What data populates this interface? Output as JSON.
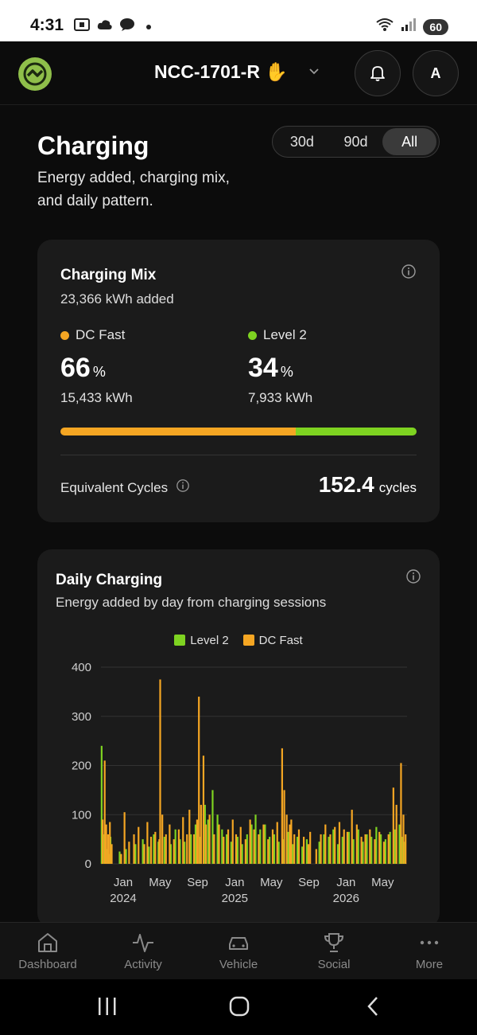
{
  "status_bar": {
    "time": "4:31",
    "battery": "60"
  },
  "header": {
    "vehicle_name": "NCC-1701-R ✋",
    "avatar_initial": "A"
  },
  "page": {
    "title": "Charging",
    "subtitle": "Energy added, charging mix, and daily pattern."
  },
  "range": {
    "options": [
      "30d",
      "90d",
      "All"
    ],
    "selected": "All"
  },
  "mix": {
    "title": "Charging Mix",
    "total": "23,366 kWh added",
    "dc": {
      "label": "DC Fast",
      "pct": "66",
      "unit": "%",
      "kwh": "15,433 kWh",
      "color": "#f5a623"
    },
    "l2": {
      "label": "Level 2",
      "pct": "34",
      "unit": "%",
      "kwh": "7,933 kWh",
      "color": "#7ed321"
    },
    "bar_fraction_dc": 0.66,
    "cycles_label": "Equivalent Cycles",
    "cycles_value": "152.4",
    "cycles_unit": "cycles"
  },
  "daily": {
    "title": "Daily Charging",
    "subtitle": "Energy added by day from charging sessions"
  },
  "chart_data": {
    "type": "bar",
    "stacked": true,
    "title": "Daily Charging",
    "legend": [
      {
        "name": "Level 2",
        "color": "#7ed321"
      },
      {
        "name": "DC Fast",
        "color": "#f5a623"
      }
    ],
    "legend_position": "top",
    "ylim": [
      0,
      400
    ],
    "yticks": [
      "400",
      "300",
      "200",
      "100",
      "0"
    ],
    "xticks": [
      {
        "label": "Jan",
        "year": "2024",
        "t": "2024-01-01"
      },
      {
        "label": "May",
        "year": "",
        "t": "2024-05-01"
      },
      {
        "label": "Sep",
        "year": "",
        "t": "2024-09-01"
      },
      {
        "label": "Jan",
        "year": "2025",
        "t": "2025-01-01"
      },
      {
        "label": "May",
        "year": "",
        "t": "2025-05-01"
      },
      {
        "label": "Sep",
        "year": "",
        "t": "2025-09-01"
      },
      {
        "label": "Jan",
        "year": "2026",
        "t": "2026-01-01"
      },
      {
        "label": "May",
        "year": "",
        "t": "2026-05-01"
      }
    ],
    "xlim": [
      "2023-10-20",
      "2026-07-20"
    ],
    "grid": true,
    "series": [
      {
        "name": "Level 2",
        "values": [
          [
            "2023-10-22",
            240
          ],
          [
            "2023-10-28",
            60
          ],
          [
            "2023-11-03",
            45
          ],
          [
            "2023-11-08",
            30
          ],
          [
            "2023-11-14",
            20
          ],
          [
            "2023-11-20",
            55
          ],
          [
            "2023-12-20",
            25
          ],
          [
            "2024-01-10",
            30
          ],
          [
            "2024-02-10",
            40
          ],
          [
            "2024-03-05",
            50
          ],
          [
            "2024-03-25",
            35
          ],
          [
            "2024-04-10",
            60
          ],
          [
            "2024-04-25",
            45
          ],
          [
            "2024-05-15",
            55
          ],
          [
            "2024-06-05",
            40
          ],
          [
            "2024-06-20",
            70
          ],
          [
            "2024-07-05",
            50
          ],
          [
            "2024-07-20",
            45
          ],
          [
            "2024-08-10",
            60
          ],
          [
            "2024-08-25",
            80
          ],
          [
            "2024-09-10",
            55
          ],
          [
            "2024-09-25",
            120
          ],
          [
            "2024-10-05",
            90
          ],
          [
            "2024-10-20",
            150
          ],
          [
            "2024-11-05",
            100
          ],
          [
            "2024-11-20",
            70
          ],
          [
            "2024-12-05",
            60
          ],
          [
            "2024-12-20",
            45
          ],
          [
            "2025-01-10",
            55
          ],
          [
            "2025-01-25",
            40
          ],
          [
            "2025-02-10",
            60
          ],
          [
            "2025-02-25",
            80
          ],
          [
            "2025-03-10",
            100
          ],
          [
            "2025-03-25",
            70
          ],
          [
            "2025-04-10",
            80
          ],
          [
            "2025-04-25",
            55
          ],
          [
            "2025-05-10",
            60
          ],
          [
            "2025-05-25",
            45
          ],
          [
            "2025-06-10",
            50
          ],
          [
            "2025-06-25",
            65
          ],
          [
            "2025-07-10",
            40
          ],
          [
            "2025-07-25",
            55
          ],
          [
            "2025-08-10",
            35
          ],
          [
            "2025-08-25",
            50
          ],
          [
            "2025-10-05",
            45
          ],
          [
            "2025-10-20",
            60
          ],
          [
            "2025-11-05",
            55
          ],
          [
            "2025-11-20",
            70
          ],
          [
            "2025-12-05",
            40
          ],
          [
            "2025-12-20",
            55
          ],
          [
            "2026-01-10",
            65
          ],
          [
            "2026-01-25",
            50
          ],
          [
            "2026-02-10",
            70
          ],
          [
            "2026-02-25",
            45
          ],
          [
            "2026-03-10",
            60
          ],
          [
            "2026-03-25",
            55
          ],
          [
            "2026-04-10",
            75
          ],
          [
            "2026-04-25",
            60
          ],
          [
            "2026-05-10",
            50
          ],
          [
            "2026-05-25",
            65
          ],
          [
            "2026-06-10",
            70
          ],
          [
            "2026-06-25",
            80
          ],
          [
            "2026-07-05",
            55
          ],
          [
            "2026-07-12",
            45
          ]
        ]
      },
      {
        "name": "DC Fast",
        "values": [
          [
            "2023-10-25",
            90
          ],
          [
            "2023-11-01",
            210
          ],
          [
            "2023-11-06",
            80
          ],
          [
            "2023-11-12",
            60
          ],
          [
            "2023-11-18",
            85
          ],
          [
            "2023-11-24",
            40
          ],
          [
            "2023-12-25",
            20
          ],
          [
            "2024-01-05",
            105
          ],
          [
            "2024-01-20",
            45
          ],
          [
            "2024-02-05",
            60
          ],
          [
            "2024-02-20",
            75
          ],
          [
            "2024-03-10",
            40
          ],
          [
            "2024-03-20",
            85
          ],
          [
            "2024-04-01",
            55
          ],
          [
            "2024-04-15",
            65
          ],
          [
            "2024-04-28",
            50
          ],
          [
            "2024-05-01",
            375
          ],
          [
            "2024-05-08",
            100
          ],
          [
            "2024-05-20",
            60
          ],
          [
            "2024-06-01",
            80
          ],
          [
            "2024-06-15",
            50
          ],
          [
            "2024-07-01",
            70
          ],
          [
            "2024-07-15",
            95
          ],
          [
            "2024-07-28",
            60
          ],
          [
            "2024-08-05",
            110
          ],
          [
            "2024-08-20",
            60
          ],
          [
            "2024-08-30",
            90
          ],
          [
            "2024-09-05",
            340
          ],
          [
            "2024-09-12",
            120
          ],
          [
            "2024-09-20",
            220
          ],
          [
            "2024-09-28",
            80
          ],
          [
            "2024-10-10",
            100
          ],
          [
            "2024-10-25",
            60
          ],
          [
            "2024-11-10",
            80
          ],
          [
            "2024-11-25",
            55
          ],
          [
            "2024-12-10",
            70
          ],
          [
            "2024-12-25",
            90
          ],
          [
            "2025-01-05",
            60
          ],
          [
            "2025-01-20",
            75
          ],
          [
            "2025-02-05",
            50
          ],
          [
            "2025-02-20",
            90
          ],
          [
            "2025-03-05",
            70
          ],
          [
            "2025-03-20",
            60
          ],
          [
            "2025-04-05",
            80
          ],
          [
            "2025-04-20",
            50
          ],
          [
            "2025-05-05",
            70
          ],
          [
            "2025-05-20",
            85
          ],
          [
            "2025-06-05",
            235
          ],
          [
            "2025-06-12",
            150
          ],
          [
            "2025-06-20",
            100
          ],
          [
            "2025-06-30",
            80
          ],
          [
            "2025-07-05",
            90
          ],
          [
            "2025-07-15",
            60
          ],
          [
            "2025-07-30",
            70
          ],
          [
            "2025-08-15",
            55
          ],
          [
            "2025-08-30",
            40
          ],
          [
            "2025-09-05",
            65
          ],
          [
            "2025-09-25",
            30
          ],
          [
            "2025-10-10",
            60
          ],
          [
            "2025-10-25",
            80
          ],
          [
            "2025-11-10",
            60
          ],
          [
            "2025-11-25",
            75
          ],
          [
            "2025-12-10",
            85
          ],
          [
            "2025-12-25",
            70
          ],
          [
            "2026-01-05",
            65
          ],
          [
            "2026-01-20",
            110
          ],
          [
            "2026-02-05",
            80
          ],
          [
            "2026-02-20",
            55
          ],
          [
            "2026-03-05",
            60
          ],
          [
            "2026-03-20",
            70
          ],
          [
            "2026-04-05",
            50
          ],
          [
            "2026-04-20",
            65
          ],
          [
            "2026-05-05",
            45
          ],
          [
            "2026-05-20",
            60
          ],
          [
            "2026-06-05",
            155
          ],
          [
            "2026-06-15",
            120
          ],
          [
            "2026-06-30",
            205
          ],
          [
            "2026-07-08",
            100
          ],
          [
            "2026-07-15",
            60
          ]
        ]
      }
    ]
  },
  "nav": {
    "items": [
      {
        "label": "Dashboard",
        "icon": "home-icon"
      },
      {
        "label": "Activity",
        "icon": "activity-icon"
      },
      {
        "label": "Vehicle",
        "icon": "car-icon"
      },
      {
        "label": "Social",
        "icon": "trophy-icon"
      },
      {
        "label": "More",
        "icon": "more-icon"
      }
    ]
  }
}
